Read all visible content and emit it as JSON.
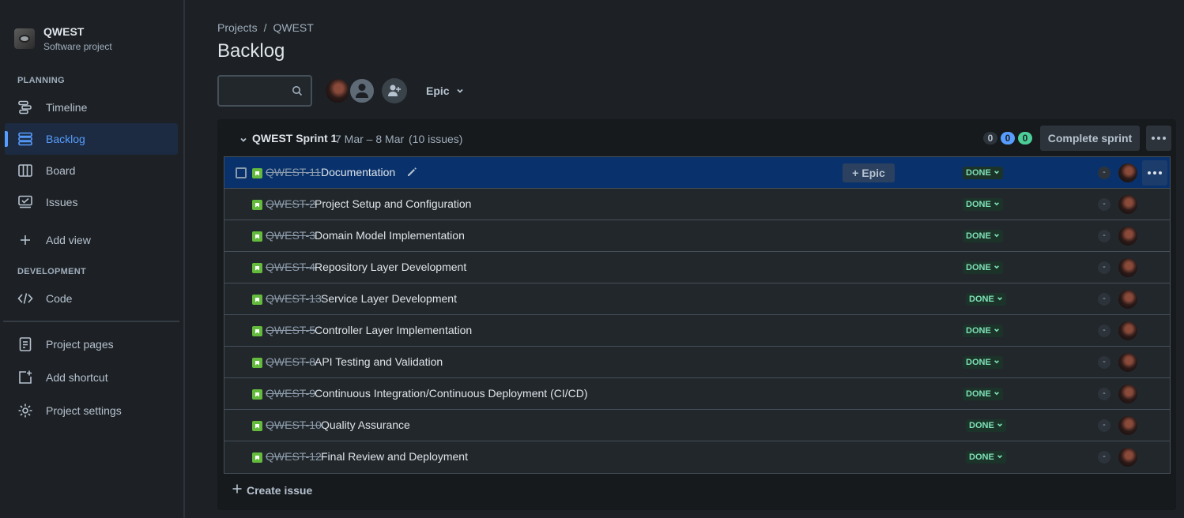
{
  "project": {
    "name": "QWEST",
    "type": "Software project"
  },
  "sidebar": {
    "planning_label": "PLANNING",
    "planning_items": [
      {
        "label": "Timeline",
        "icon": "timeline-icon"
      },
      {
        "label": "Backlog",
        "icon": "backlog-icon",
        "active": true
      },
      {
        "label": "Board",
        "icon": "board-icon"
      },
      {
        "label": "Issues",
        "icon": "issues-icon"
      },
      {
        "label": "Add view",
        "icon": "plus-icon"
      }
    ],
    "development_label": "DEVELOPMENT",
    "development_items": [
      {
        "label": "Code",
        "icon": "code-icon"
      }
    ],
    "footer_items": [
      {
        "label": "Project pages",
        "icon": "page-icon"
      },
      {
        "label": "Add shortcut",
        "icon": "add-shortcut-icon"
      },
      {
        "label": "Project settings",
        "icon": "gear-icon"
      }
    ]
  },
  "breadcrumb": {
    "root": "Projects",
    "separator": "/",
    "current": "QWEST"
  },
  "page_title": "Backlog",
  "filters": {
    "search_placeholder": "",
    "epic_label": "Epic"
  },
  "sprint": {
    "name": "QWEST Sprint 1",
    "dates": "7 Mar – 8 Mar",
    "issue_count": "(10 issues)",
    "counts": {
      "todo": "0",
      "in_progress": "0",
      "done": "0"
    },
    "complete_label": "Complete sprint",
    "issues": [
      {
        "key": "QWEST-11",
        "summary": "Documentation",
        "status": "DONE",
        "estimate": "-",
        "selected": true
      },
      {
        "key": "QWEST-2",
        "summary": "Project Setup and Configuration",
        "status": "DONE",
        "estimate": "-"
      },
      {
        "key": "QWEST-3",
        "summary": "Domain Model Implementation",
        "status": "DONE",
        "estimate": "-"
      },
      {
        "key": "QWEST-4",
        "summary": "Repository Layer Development",
        "status": "DONE",
        "estimate": "-"
      },
      {
        "key": "QWEST-13",
        "summary": "Service Layer Development",
        "status": "DONE",
        "estimate": "-"
      },
      {
        "key": "QWEST-5",
        "summary": "Controller Layer Implementation",
        "status": "DONE",
        "estimate": "-"
      },
      {
        "key": "QWEST-8",
        "summary": "API Testing and Validation",
        "status": "DONE",
        "estimate": "-"
      },
      {
        "key": "QWEST-9",
        "summary": "Continuous Integration/Continuous Deployment (CI/CD)",
        "status": "DONE",
        "estimate": "-"
      },
      {
        "key": "QWEST-10",
        "summary": "Quality Assurance",
        "status": "DONE",
        "estimate": "-"
      },
      {
        "key": "QWEST-12",
        "summary": "Final Review and Deployment",
        "status": "DONE",
        "estimate": "-"
      }
    ],
    "add_epic_label": "Epic",
    "create_label": "Create issue"
  },
  "colors": {
    "accent": "#579dff",
    "selected_row": "#09326c",
    "done_text": "#7ee2b8",
    "story": "#63ba3c"
  }
}
